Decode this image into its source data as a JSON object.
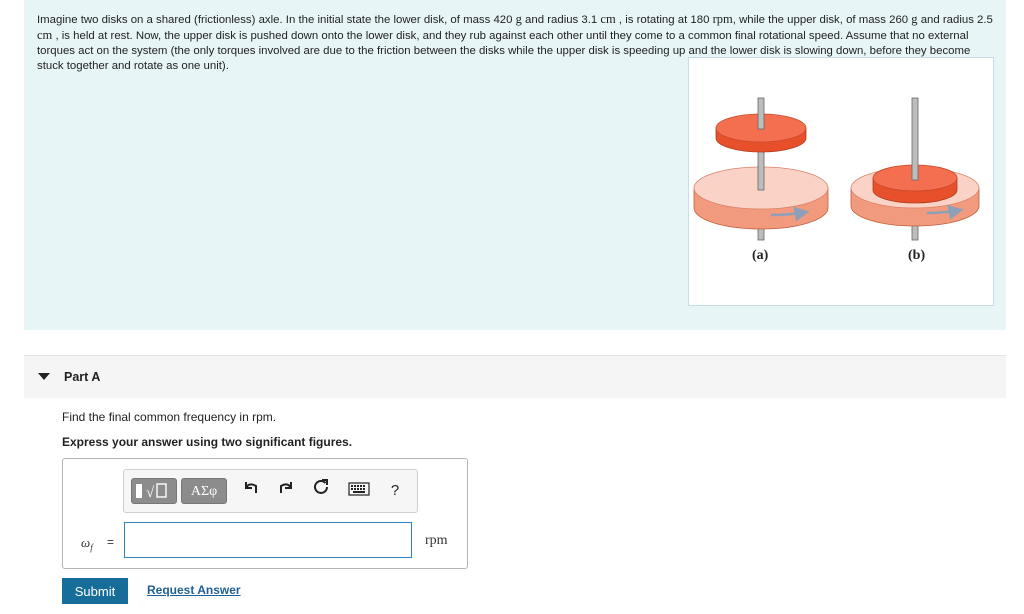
{
  "problem": {
    "segments": [
      {
        "text": "Imagine two disks on a shared (frictionless) axle. In the initial state the lower disk, of mass 420 "
      },
      {
        "text": "g",
        "serif": true
      },
      {
        "text": " and radius 3.1 "
      },
      {
        "text": "cm",
        "serif": true
      },
      {
        "text": " , is rotating at 180 "
      },
      {
        "text": "rpm",
        "serif": true
      },
      {
        "text": ", while the upper disk, of mass 260 "
      },
      {
        "text": "g",
        "serif": true
      },
      {
        "text": " and radius 2.5 "
      },
      {
        "text": "cm",
        "serif": true
      },
      {
        "text": " , is held at rest. Now, the upper disk is pushed down onto the lower disk, and they rub against each other until they come to a common final rotational speed. Assume that no external torques act on the system (the only torques involved are due to the friction between the disks while the upper disk is speeding up and the lower disk is slowing down, before they become stuck together and rotate as one unit)."
      }
    ],
    "figure": {
      "label_a": "(a)",
      "label_b": "(b)",
      "colors": {
        "lower_disk_top": "#fbd3c6",
        "lower_disk_side": "#f29a7e",
        "upper_disk_top": "#f36f50",
        "upper_disk_side": "#e8502c",
        "axle": "#bdbdbd",
        "arrow": "#8e9fb8"
      }
    }
  },
  "part": {
    "title": "Part A",
    "question": "Find the final common frequency in rpm.",
    "instruction": "Express your answer using two significant figures."
  },
  "toolbar": {
    "templates_icon": "template-icon",
    "greek_label": "ΑΣφ",
    "undo_icon": "undo-icon",
    "redo_icon": "redo-icon",
    "reset_icon": "reset-icon",
    "keyboard_icon": "keyboard-icon",
    "help_label": "?"
  },
  "answer": {
    "variable": "ω",
    "subscript": "f",
    "equals": "=",
    "value": "",
    "unit": "rpm"
  },
  "actions": {
    "submit_label": "Submit",
    "request_label": "Request Answer"
  },
  "colors": {
    "problem_bg": "#e8f5f6",
    "submit_bg": "#166d99",
    "link": "#1f5f95",
    "input_border": "#2f7fb5"
  }
}
